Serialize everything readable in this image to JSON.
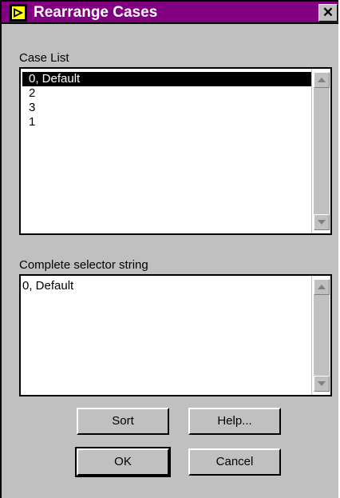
{
  "window": {
    "title": "Rearrange Cases",
    "close_glyph": "✕",
    "title_color": "#800080"
  },
  "case_list": {
    "label": "Case List",
    "items": [
      "0, Default",
      "2",
      "3",
      "1"
    ],
    "selected_index": 0
  },
  "selector": {
    "label": "Complete selector string",
    "value": "0, Default"
  },
  "buttons": {
    "sort": "Sort",
    "help": "Help...",
    "ok": "OK",
    "cancel": "Cancel"
  },
  "icons": {
    "app": "labview-run-arrow-icon",
    "scroll_up": "scroll-up-arrow-icon",
    "scroll_down": "scroll-down-arrow-icon"
  }
}
